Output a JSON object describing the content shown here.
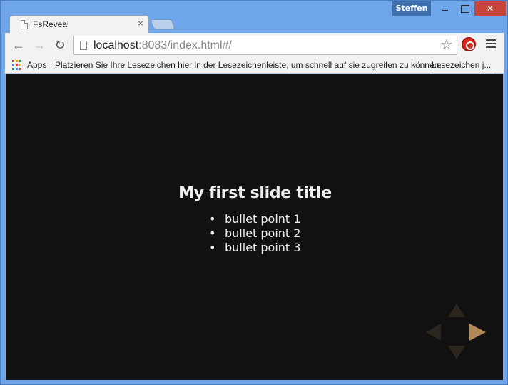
{
  "window": {
    "user_badge": "Steffen",
    "close_glyph": "✕"
  },
  "tab": {
    "title": "FsReveal",
    "close_glyph": "×"
  },
  "toolbar": {
    "back_glyph": "←",
    "forward_glyph": "→",
    "reload_glyph": "↻",
    "url_host": "localhost",
    "url_rest": ":8083/index.html#/",
    "star_glyph": "☆"
  },
  "bookmarks": {
    "apps_label": "Apps",
    "hint": "Platzieren Sie Ihre Lesezeichen hier in der Lesezeichenleiste, um schnell auf sie zugreifen zu können.",
    "link": "Lesezeichen j..."
  },
  "slide": {
    "title": "My first slide title",
    "bullets": [
      "bullet point 1",
      "bullet point 2",
      "bullet point 3"
    ]
  },
  "colors": {
    "slide_background": "#111111",
    "nav_active_arrow": "#b0885a",
    "nav_inactive_arrow": "#2b2620"
  },
  "icons": {
    "apps_grid": [
      "#e33b2e",
      "#f4b400",
      "#0f9d58",
      "#4285f4",
      "#e33b2e",
      "#f4b400",
      "#0f9d58",
      "#4285f4",
      "#e33b2e"
    ]
  }
}
